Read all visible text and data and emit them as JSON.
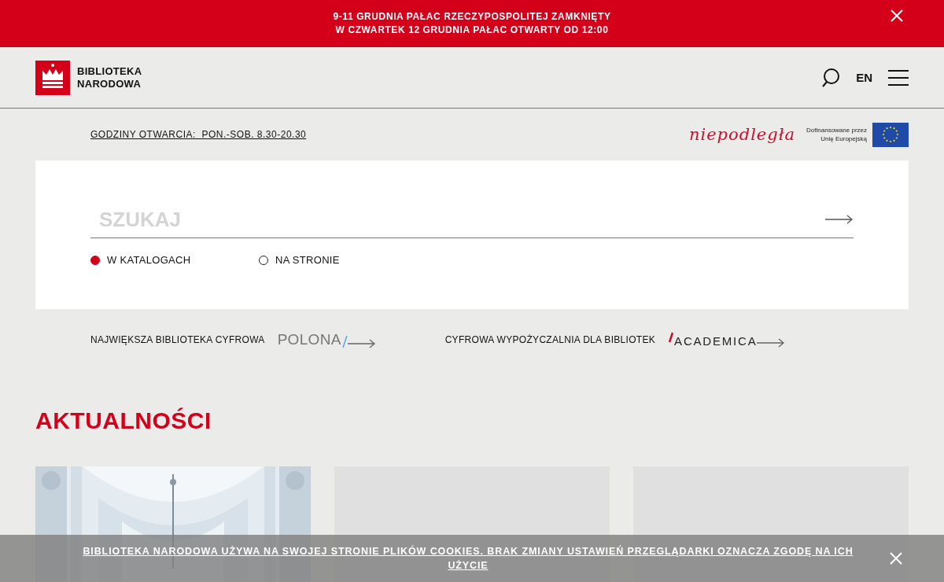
{
  "alert_bar": {
    "lines": [
      "9-11 GRUDNIA PAŁAC RZECZYPOSPOLITEJ ZAMKNIĘTY",
      "W CZWARTEK 12 GRUDNIA PAŁAC OTWARTY OD 12:00"
    ]
  },
  "header": {
    "logo_lines": [
      "BIBLIOTEKA",
      "NARODOWA"
    ],
    "language": "EN"
  },
  "info_bar": {
    "opening_hours": "GODZINY OTWARCIA:  PON.-SOB. 8.30-20.30",
    "campaign_logo": "niepodległa",
    "eu_note_lines": [
      "Dofinansowane przez",
      "Unię Europejską"
    ]
  },
  "search": {
    "placeholder": "SZUKAJ",
    "scopes": [
      {
        "label": "W KATALOGACH",
        "selected": true
      },
      {
        "label": "NA STRONIE",
        "selected": false
      }
    ]
  },
  "promo_links": [
    {
      "label": "NAJWIĘKSZA BIBLIOTEKA CYFROWA",
      "brand": "POLONA",
      "kind": "polona"
    },
    {
      "label": "CYFROWA WYPOŻYCZALNIA DLA BIBLIOTEK",
      "brand": "ACADEMICA",
      "kind": "academica"
    }
  ],
  "news": {
    "heading": "AKTUALNOŚCI",
    "cards": [
      {
        "kind": "picture"
      },
      {
        "kind": "empty"
      },
      {
        "kind": "empty"
      }
    ]
  },
  "cookie_notice": {
    "text": "BIBLIOTEKA NARODOWA UŻYWA NA SWOJEJ STRONIE PLIKÓW COOKIES. BRAK ZMIANY USTAWIEŃ PRZEGLĄDARKI OZNACZA ZGODĘ NA ICH UŻYCIE"
  }
}
